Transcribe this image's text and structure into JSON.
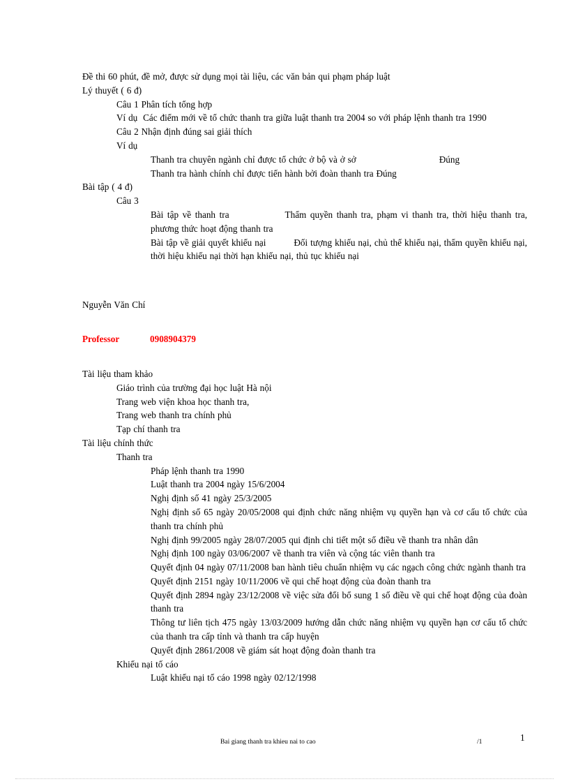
{
  "document": {
    "exam_info": "Đề thi 60 phút, đề mở, được sử dụng mọi tài liệu,  các văn bản qui phạm pháp luật",
    "theory_heading": "Lý thuyết ( 6 đ)",
    "q1_label": "Câu 1   Phân tích tổng hợp",
    "q1_example_label": "Ví dụ",
    "q1_example_text": "Các điểm mới  về tổ chức thanh  tra giữa luật thanh  tra 2004 so với pháp lệnh  thanh tra 1990",
    "q2_label": "Câu 2   Nhận định đúng sai giải  thích",
    "q2_example_label": "Ví dụ",
    "q2_item1": "Thanh  tra chuyên  ngành  chỉ được tổ chức ở bộ và ở sở",
    "q2_item1_answer": "Đúng",
    "q2_item2": "Thanh  tra hành  chính  chỉ được tiến  hành bởi đoàn thanh  tra Đúng",
    "exercise_heading": "Bài tập ( 4 đ)",
    "q3_label": "Câu 3",
    "q3_item1_label": "Bài tập về thanh  tra",
    "q3_item1_text": "Thẩm  quyền  thanh  tra, phạm  vi thanh  tra,  thời hiệu thanh  tra, phương  thức hoạt động thanh  tra",
    "q3_item2_label": "Bài tập về giải  quyết khiếu  nại",
    "q3_item2_text": "Đối tượng khiếu  nại,  chủ thể  khiếu  nại,  thẩm quyền khiếu  nại, thời hiệu khiếu  nại thời hạn khiếu  nại,  thủ tục khiếu  nại",
    "author_name": "Nguyễn  Văn Chí",
    "professor_label": "Professor",
    "professor_phone": "0908904379",
    "refs_heading": "Tài liệu  tham  khảo",
    "refs_items": [
      "Giáo trình  của trường  đại học luật  Hà nội",
      "Trang web viện  khoa học thanh  tra,",
      "Trang web thanh  tra chính  phủ",
      "Tạp chí thanh  tra"
    ],
    "official_heading": "Tài liệu  chính  thức",
    "group1_heading": "Thanh  tra",
    "group1_items": [
      "Pháp lệnh  thanh  tra 1990",
      "Luật thanh  tra 2004 ngày  15/6/2004",
      "Nghị định số 41 ngày 25/3/2005",
      "Nghị  định  số 65 ngày  20/05/2008 qui  định  chức năng  nhiệm  vụ quyền  hạn và cơ cấu tổ chức của thanh  tra chính  phủ",
      "Nghị  định  99/2005 ngày  28/07/2005 qui  định  chi tiết một  số điều  về thanh  tra nhân dân",
      "Nghị  định  100 ngày  03/06/2007 về thanh  tra viên  và cộng tác viên  thanh  tra",
      "Quyết định  04 ngày  07/11/2008 ban hành  tiêu  chuẩn  nhiệm  vụ các ngạch  công chức ngành  thanh  tra",
      "Quyết định  2151 ngày  10/11/2006 về qui chế hoạt động của đoàn thanh  tra",
      "Quyết định  2894 ngày  23/12/2008 về việc  sửa đổi bổ sung  1 số điều  về qui  chế hoạt động của đoàn thanh  tra",
      "Thông tư liên  tịch 475 ngày  13/03/2009 hướng  dẫn chức năng  nhiệm  vụ quyền hạn cơ cấu tổ chức của thanh  tra cấp tỉnh  và thanh  tra cấp huyện",
      "Quyết định  2861/2008 về giám  sát hoạt động đoàn thanh  tra"
    ],
    "group2_heading": "Khiếu  nại tố cáo",
    "group2_items": [
      "Luật khiếu  nại tố cáo 1998 ngày  02/12/1998"
    ]
  },
  "footer": {
    "title": "Bai giang thanh tra khieu nai to cao",
    "page_of": "/1",
    "page_number": "1"
  },
  "colors": {
    "accent_red": "#ff0000",
    "text": "#000000",
    "page_background": "#ffffff"
  }
}
